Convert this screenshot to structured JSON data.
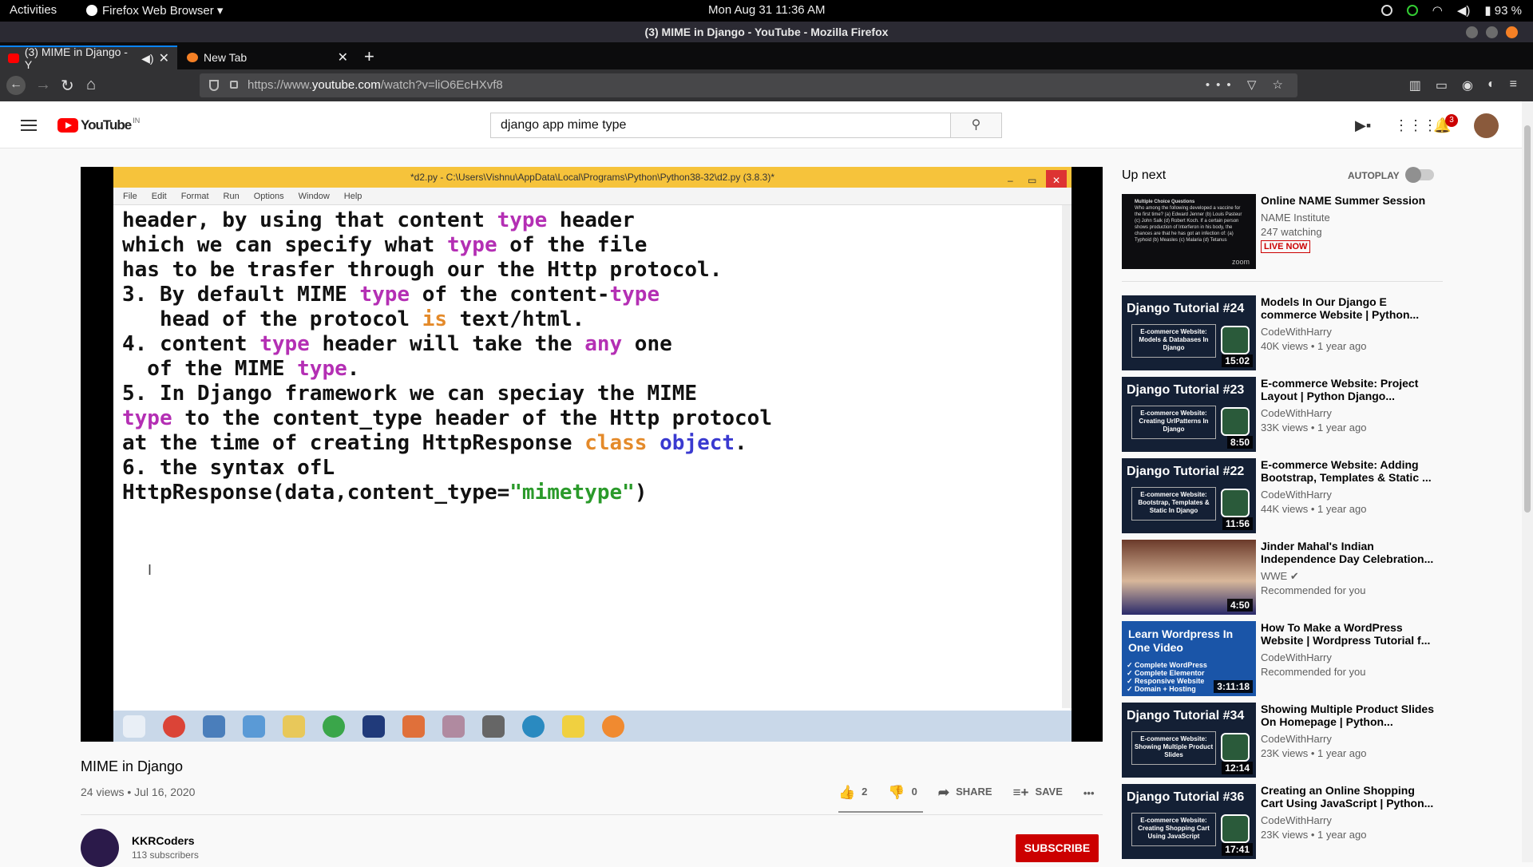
{
  "system": {
    "activities": "Activities",
    "app_name": "Firefox Web Browser ▾",
    "clock": "Mon Aug 31  11:36 AM",
    "battery": "93 %"
  },
  "browser": {
    "window_title": "(3) MIME in Django - YouTube - Mozilla Firefox",
    "tabs": [
      {
        "label": "(3) MIME in Django - Y"
      },
      {
        "label": "New Tab"
      }
    ],
    "url_prefix": "https://www.",
    "url_host": "youtube.com",
    "url_path": "/watch?v=liO6EcHXvf8"
  },
  "youtube": {
    "logo_text": "YouTube",
    "country": "IN",
    "search_value": "django app mime type",
    "notifications": "3"
  },
  "video": {
    "window_caption": "*d2.py - C:\\Users\\Vishnu\\AppData\\Local\\Programs\\Python\\Python38-32\\d2.py (3.8.3)*",
    "menu": [
      "File",
      "Edit",
      "Format",
      "Run",
      "Options",
      "Window",
      "Help"
    ],
    "title": "MIME in Django",
    "meta": "24 views • Jul 16, 2020",
    "likes": "2",
    "dislikes": "0",
    "share": "SHARE",
    "save": "SAVE",
    "more": "•••"
  },
  "channel": {
    "name": "KKRCoders",
    "subs": "113 subscribers",
    "subscribe": "SUBSCRIBE"
  },
  "sidebar": {
    "up_next": "Up next",
    "autoplay": "AUTOPLAY",
    "items": [
      {
        "title": "Online NAME Summer Session",
        "channel": "NAME Institute",
        "views": "247 watching",
        "badge": "LIVE NOW",
        "thumb_text": "Multiple Choice Questions",
        "thumb_q": "Who among the following developed a vaccine for the first time? (a) Edward Jenner (b) Louis Pasteur (c) John Salk (d) Robert Koch. If a certain person shows production of Interferon in his body, the chances are that he has got an infection of: (a) Typhoid (b) Measles (c) Malaria (d) Tetanus",
        "thumb_mark": "zoom"
      },
      {
        "title": "Models In Our Django E commerce Website | Python...",
        "channel": "CodeWithHarry",
        "views": "40K views • 1 year ago",
        "duration": "15:02",
        "thumb_title": "Django Tutorial #24",
        "thumb_box": "E-commerce Website: Models & Databases In Django"
      },
      {
        "title": "E-commerce Website: Project Layout | Python Django...",
        "channel": "CodeWithHarry",
        "views": "33K views • 1 year ago",
        "duration": "8:50",
        "thumb_title": "Django Tutorial #23",
        "thumb_box": "E-commerce Website: Creating UrlPatterns In Django"
      },
      {
        "title": "E-commerce Website: Adding Bootstrap, Templates & Static ...",
        "channel": "CodeWithHarry",
        "views": "44K views • 1 year ago",
        "duration": "11:56",
        "thumb_title": "Django Tutorial #22",
        "thumb_box": "E-commerce Website: Bootstrap, Templates & Static In Django"
      },
      {
        "title": "Jinder Mahal's Indian Independence Day Celebration...",
        "channel": "WWE",
        "views": "Recommended for you",
        "duration": "4:50"
      },
      {
        "title": "How To Make a WordPress Website | Wordpress Tutorial f...",
        "channel": "CodeWithHarry",
        "views": "Recommended for you",
        "duration": "3:11:18",
        "thumb_title": "Learn Wordpress In One Video",
        "thumb_box": "✓ Complete WordPress ✓ Complete Elementor ✓ Responsive Website ✓ Domain + Hosting"
      },
      {
        "title": "Showing Multiple Product Slides On Homepage | Python...",
        "channel": "CodeWithHarry",
        "views": "23K views • 1 year ago",
        "duration": "12:14",
        "thumb_title": "Django Tutorial #34",
        "thumb_box": "E-commerce Website: Showing Multiple Product Slides"
      },
      {
        "title": "Creating an Online Shopping Cart Using JavaScript | Python...",
        "channel": "CodeWithHarry",
        "views": "23K views • 1 year ago",
        "duration": "17:41",
        "thumb_title": "Django Tutorial #36",
        "thumb_box": "E-commerce Website: Creating Shopping Cart Using JavaScript"
      }
    ]
  }
}
